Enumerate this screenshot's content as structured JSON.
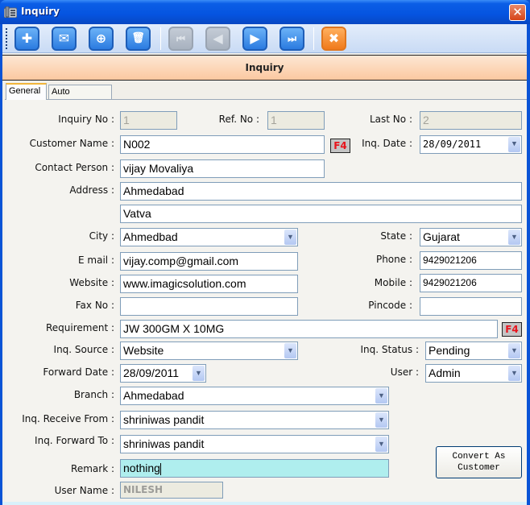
{
  "window": {
    "title": "Inquiry",
    "icon": "telephone-icon",
    "close_glyph": "✕"
  },
  "toolbar": {
    "buttons": [
      {
        "name": "add",
        "icon": "plus-icon",
        "glyph": "✚",
        "enabled": true
      },
      {
        "name": "email",
        "icon": "envelope-icon",
        "glyph": "✉",
        "enabled": true
      },
      {
        "name": "search",
        "icon": "zoom-in-icon",
        "glyph": "⊕",
        "enabled": true
      },
      {
        "name": "delete",
        "icon": "trash-icon",
        "glyph": "🗑",
        "enabled": true
      },
      {
        "name": "first",
        "icon": "first-record-icon",
        "glyph": "⏮",
        "enabled": false
      },
      {
        "name": "previous",
        "icon": "previous-record-icon",
        "glyph": "◀",
        "enabled": false
      },
      {
        "name": "next",
        "icon": "next-record-icon",
        "glyph": "▶",
        "enabled": true
      },
      {
        "name": "last",
        "icon": "last-record-icon",
        "glyph": "⏭",
        "enabled": true
      },
      {
        "name": "close",
        "icon": "close-icon",
        "glyph": "✖",
        "enabled": true
      }
    ]
  },
  "header": {
    "title": "Inquiry"
  },
  "tabs": [
    {
      "label": "General",
      "active": true
    },
    {
      "label": "Auto Reminder",
      "active": false
    }
  ],
  "form": {
    "inquiry_no": {
      "label": "Inquiry No :",
      "value": "1"
    },
    "ref_no": {
      "label": "Ref. No :",
      "value": "1"
    },
    "last_no": {
      "label": "Last No :",
      "value": "2"
    },
    "customer_name": {
      "label": "Customer Name :",
      "value": "N002"
    },
    "f4_label": "F4",
    "inq_date": {
      "label": "Inq. Date :",
      "value": "28/09/2011"
    },
    "contact_person": {
      "label": "Contact Person :",
      "value": "vijay Movaliya"
    },
    "address": {
      "label": "Address :",
      "line1": "Ahmedabad",
      "line2": "Vatva"
    },
    "city": {
      "label": "City :",
      "value": "Ahmedbad"
    },
    "state": {
      "label": "State :",
      "value": "Gujarat"
    },
    "email": {
      "label": "E mail :",
      "value": "vijay.comp@gmail.com"
    },
    "phone": {
      "label": "Phone :",
      "value": "9429021206"
    },
    "website": {
      "label": "Website :",
      "value": "www.imagicsolution.com"
    },
    "mobile": {
      "label": "Mobile :",
      "value": "9429021206"
    },
    "fax_no": {
      "label": "Fax No :",
      "value": ""
    },
    "pincode": {
      "label": "Pincode :",
      "value": ""
    },
    "requirement": {
      "label": "Requirement :",
      "value": "JW 300GM X 10MG"
    },
    "inq_source": {
      "label": "Inq. Source :",
      "value": "Website"
    },
    "inq_status": {
      "label": "Inq. Status :",
      "value": "Pending"
    },
    "forward_date": {
      "label": "Forward Date :",
      "value": "28/09/2011"
    },
    "user": {
      "label": "User :",
      "value": "Admin"
    },
    "branch": {
      "label": "Branch :",
      "value": "Ahmedabad"
    },
    "inq_receive_from": {
      "label": "Inq. Receive From :",
      "value": "shriniwas pandit"
    },
    "inq_forward_to": {
      "label": "Inq. Forward To :",
      "value": "shriniwas pandit"
    },
    "remark": {
      "label": "Remark :",
      "value": "nothing"
    },
    "user_name": {
      "label": "User Name :",
      "value": "NILESH"
    },
    "convert_button": {
      "line1": "Convert As",
      "line2": "Customer"
    }
  }
}
